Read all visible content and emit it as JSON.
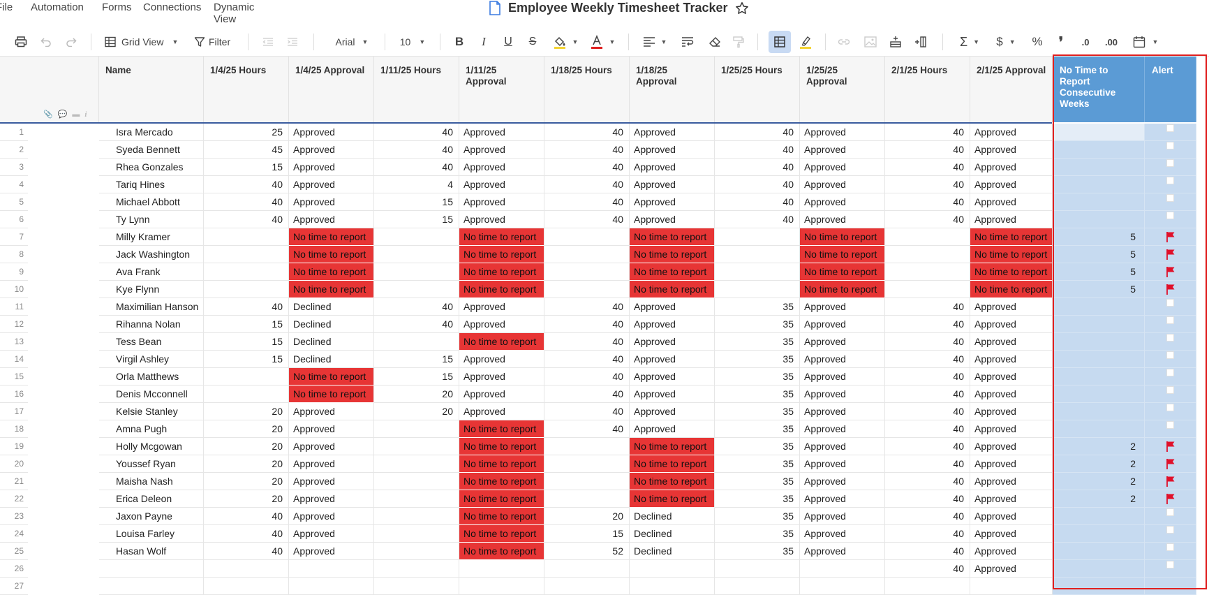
{
  "menu": [
    "File",
    "Automation",
    "Forms",
    "Connections",
    "Dynamic View"
  ],
  "title": "Employee Weekly Timesheet Tracker",
  "toolbar": {
    "view_label": "Grid View",
    "filter_label": "Filter",
    "font_name": "Arial",
    "font_size": "10"
  },
  "columns": [
    "Name",
    "1/4/25 Hours",
    "1/4/25 Approval",
    "1/11/25 Hours",
    "1/11/25 Approval",
    "1/18/25 Hours",
    "1/18/25 Approval",
    "1/25/25 Hours",
    "1/25/25 Approval",
    "2/1/25 Hours",
    "2/1/25 Approval",
    "No Time to Report Consecutive Weeks",
    "Alert"
  ],
  "rows": [
    {
      "n": "1",
      "name": "Isra Mercado",
      "c": [
        "25",
        "Approved",
        "40",
        "Approved",
        "40",
        "Approved",
        "40",
        "Approved",
        "40",
        "Approved"
      ],
      "weeks": "",
      "alert": false
    },
    {
      "n": "2",
      "name": "Syeda Bennett",
      "c": [
        "45",
        "Approved",
        "40",
        "Approved",
        "40",
        "Approved",
        "40",
        "Approved",
        "40",
        "Approved"
      ],
      "weeks": "",
      "alert": false
    },
    {
      "n": "3",
      "name": "Rhea Gonzales",
      "c": [
        "15",
        "Approved",
        "40",
        "Approved",
        "40",
        "Approved",
        "40",
        "Approved",
        "40",
        "Approved"
      ],
      "weeks": "",
      "alert": false
    },
    {
      "n": "4",
      "name": "Tariq Hines",
      "c": [
        "40",
        "Approved",
        "4",
        "Approved",
        "40",
        "Approved",
        "40",
        "Approved",
        "40",
        "Approved"
      ],
      "weeks": "",
      "alert": false
    },
    {
      "n": "5",
      "name": "Michael Abbott",
      "c": [
        "40",
        "Approved",
        "15",
        "Approved",
        "40",
        "Approved",
        "40",
        "Approved",
        "40",
        "Approved"
      ],
      "weeks": "",
      "alert": false
    },
    {
      "n": "6",
      "name": "Ty Lynn",
      "c": [
        "40",
        "Approved",
        "15",
        "Approved",
        "40",
        "Approved",
        "40",
        "Approved",
        "40",
        "Approved"
      ],
      "weeks": "",
      "alert": false
    },
    {
      "n": "7",
      "name": "Milly Kramer",
      "c": [
        "",
        "No time to report",
        "",
        "No time to report",
        "",
        "No time to report",
        "",
        "No time to report",
        "",
        "No time to report"
      ],
      "weeks": "5",
      "alert": true
    },
    {
      "n": "8",
      "name": "Jack Washington",
      "c": [
        "",
        "No time to report",
        "",
        "No time to report",
        "",
        "No time to report",
        "",
        "No time to report",
        "",
        "No time to report"
      ],
      "weeks": "5",
      "alert": true
    },
    {
      "n": "9",
      "name": "Ava Frank",
      "c": [
        "",
        "No time to report",
        "",
        "No time to report",
        "",
        "No time to report",
        "",
        "No time to report",
        "",
        "No time to report"
      ],
      "weeks": "5",
      "alert": true
    },
    {
      "n": "10",
      "name": "Kye Flynn",
      "c": [
        "",
        "No time to report",
        "",
        "No time to report",
        "",
        "No time to report",
        "",
        "No time to report",
        "",
        "No time to report"
      ],
      "weeks": "5",
      "alert": true
    },
    {
      "n": "11",
      "name": "Maximilian Hanson",
      "c": [
        "40",
        "Declined",
        "40",
        "Approved",
        "40",
        "Approved",
        "35",
        "Approved",
        "40",
        "Approved"
      ],
      "weeks": "",
      "alert": false
    },
    {
      "n": "12",
      "name": "Rihanna Nolan",
      "c": [
        "15",
        "Declined",
        "40",
        "Approved",
        "40",
        "Approved",
        "35",
        "Approved",
        "40",
        "Approved"
      ],
      "weeks": "",
      "alert": false
    },
    {
      "n": "13",
      "name": "Tess Bean",
      "c": [
        "15",
        "Declined",
        "",
        "No time to report",
        "40",
        "Approved",
        "35",
        "Approved",
        "40",
        "Approved"
      ],
      "weeks": "",
      "alert": false
    },
    {
      "n": "14",
      "name": "Virgil Ashley",
      "c": [
        "15",
        "Declined",
        "15",
        "Approved",
        "40",
        "Approved",
        "35",
        "Approved",
        "40",
        "Approved"
      ],
      "weeks": "",
      "alert": false
    },
    {
      "n": "15",
      "name": "Orla Matthews",
      "c": [
        "",
        "No time to report",
        "15",
        "Approved",
        "40",
        "Approved",
        "35",
        "Approved",
        "40",
        "Approved"
      ],
      "weeks": "",
      "alert": false
    },
    {
      "n": "16",
      "name": "Denis Mcconnell",
      "c": [
        "",
        "No time to report",
        "20",
        "Approved",
        "40",
        "Approved",
        "35",
        "Approved",
        "40",
        "Approved"
      ],
      "weeks": "",
      "alert": false
    },
    {
      "n": "17",
      "name": "Kelsie Stanley",
      "c": [
        "20",
        "Approved",
        "20",
        "Approved",
        "40",
        "Approved",
        "35",
        "Approved",
        "40",
        "Approved"
      ],
      "weeks": "",
      "alert": false
    },
    {
      "n": "18",
      "name": "Amna Pugh",
      "c": [
        "20",
        "Approved",
        "",
        "No time to report",
        "40",
        "Approved",
        "35",
        "Approved",
        "40",
        "Approved"
      ],
      "weeks": "",
      "alert": false
    },
    {
      "n": "19",
      "name": "Holly Mcgowan",
      "c": [
        "20",
        "Approved",
        "",
        "No time to report",
        "",
        "No time to report",
        "35",
        "Approved",
        "40",
        "Approved"
      ],
      "weeks": "2",
      "alert": true
    },
    {
      "n": "20",
      "name": "Youssef Ryan",
      "c": [
        "20",
        "Approved",
        "",
        "No time to report",
        "",
        "No time to report",
        "35",
        "Approved",
        "40",
        "Approved"
      ],
      "weeks": "2",
      "alert": true
    },
    {
      "n": "21",
      "name": "Maisha Nash",
      "c": [
        "20",
        "Approved",
        "",
        "No time to report",
        "",
        "No time to report",
        "35",
        "Approved",
        "40",
        "Approved"
      ],
      "weeks": "2",
      "alert": true
    },
    {
      "n": "22",
      "name": "Erica Deleon",
      "c": [
        "20",
        "Approved",
        "",
        "No time to report",
        "",
        "No time to report",
        "35",
        "Approved",
        "40",
        "Approved"
      ],
      "weeks": "2",
      "alert": true
    },
    {
      "n": "23",
      "name": "Jaxon Payne",
      "c": [
        "40",
        "Approved",
        "",
        "No time to report",
        "20",
        "Declined",
        "35",
        "Approved",
        "40",
        "Approved"
      ],
      "weeks": "",
      "alert": false
    },
    {
      "n": "24",
      "name": "Louisa Farley",
      "c": [
        "40",
        "Approved",
        "",
        "No time to report",
        "15",
        "Declined",
        "35",
        "Approved",
        "40",
        "Approved"
      ],
      "weeks": "",
      "alert": false
    },
    {
      "n": "25",
      "name": "Hasan Wolf",
      "c": [
        "40",
        "Approved",
        "",
        "No time to report",
        "52",
        "Declined",
        "35",
        "Approved",
        "40",
        "Approved"
      ],
      "weeks": "",
      "alert": false
    },
    {
      "n": "26",
      "name": "",
      "c": [
        "",
        "",
        "",
        "",
        "",
        "",
        "",
        "",
        "40",
        "Approved"
      ],
      "weeks": "",
      "alert": false
    },
    {
      "n": "27",
      "name": "",
      "c": [
        "",
        "",
        "",
        "",
        "",
        "",
        "",
        "",
        "",
        ""
      ],
      "weeks": "",
      "alert": false
    }
  ],
  "colors": {
    "red": "#e73535",
    "blue_header": "#5b9bd5",
    "blue_cell": "#c6daf0",
    "flag": "#e0102a",
    "highlight": "#e02020"
  }
}
